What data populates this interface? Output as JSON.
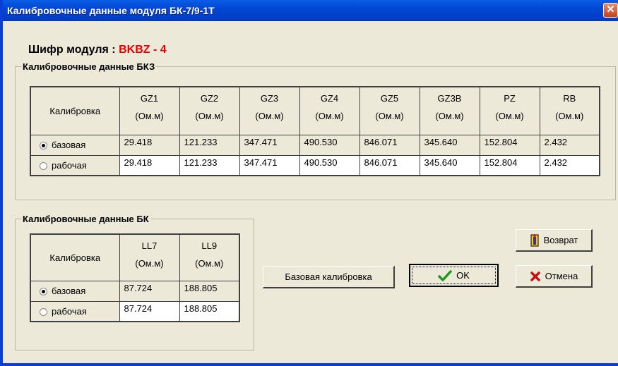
{
  "window": {
    "title": "Калибровочные данные модуля БК-7/9-1Т",
    "close": "✕"
  },
  "module": {
    "label": "Шифр модуля : ",
    "code": "BKBZ - 4"
  },
  "bkz": {
    "legend": "Калибровочные данные БКЗ",
    "head": "Калибровка",
    "columns": [
      {
        "name": "GZ1",
        "unit": "(Ом.м)"
      },
      {
        "name": "GZ2",
        "unit": "(Ом.м)"
      },
      {
        "name": "GZ3",
        "unit": "(Ом.м)"
      },
      {
        "name": "GZ4",
        "unit": "(Ом.м)"
      },
      {
        "name": "GZ5",
        "unit": "(Ом.м)"
      },
      {
        "name": "GZ3B",
        "unit": "(Ом.м)"
      },
      {
        "name": "PZ",
        "unit": "(Ом.м)"
      },
      {
        "name": "RB",
        "unit": "(Ом.м)"
      }
    ],
    "rows": [
      {
        "label": "базовая",
        "selected": true,
        "values": [
          "29.418",
          "121.233",
          "347.471",
          "490.530",
          "846.071",
          "345.640",
          "152.804",
          "2.432"
        ]
      },
      {
        "label": "рабочая",
        "selected": false,
        "values": [
          "29.418",
          "121.233",
          "347.471",
          "490.530",
          "846.071",
          "345.640",
          "152.804",
          "2.432"
        ]
      }
    ]
  },
  "bk": {
    "legend": "Калибровочные данные БК",
    "head": "Калибровка",
    "columns": [
      {
        "name": "LL7",
        "unit": "(Ом.м)"
      },
      {
        "name": "LL9",
        "unit": "(Ом.м)"
      }
    ],
    "rows": [
      {
        "label": "базовая",
        "selected": true,
        "values": [
          "87.724",
          "188.805"
        ]
      },
      {
        "label": "рабочая",
        "selected": false,
        "values": [
          "87.724",
          "188.805"
        ]
      }
    ]
  },
  "buttons": {
    "base_calibration": "Базовая калибровка",
    "ok": "OK",
    "back": "Возврат",
    "cancel": "Отмена"
  },
  "icons": {
    "ok": "checkmark-icon",
    "cancel": "x-icon",
    "back": "door-exit-icon"
  }
}
